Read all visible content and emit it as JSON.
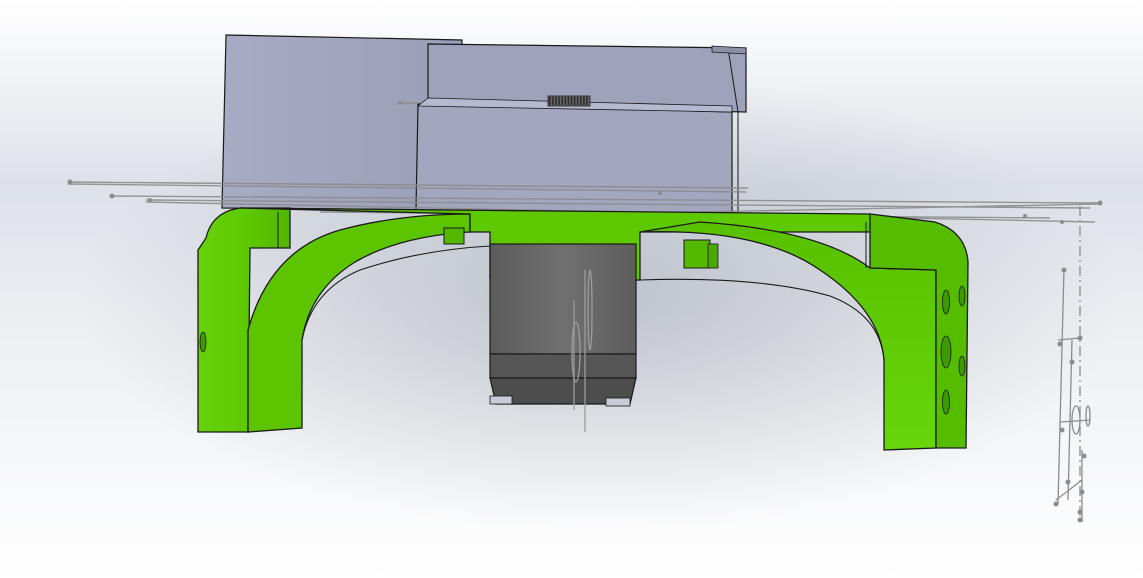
{
  "window": {
    "title": ""
  },
  "scene": {
    "background": {
      "top_color": "#ffffff",
      "mid_color": "#dde1e8",
      "bottom_color": "#ffffff"
    },
    "colors": {
      "green_body": "#5fcc00",
      "green_highlight": "#8ee63a",
      "green_shadow": "#3e9a00",
      "blue_grey_block": "#a0a4bd",
      "blue_grey_light": "#b3b7cd",
      "blue_grey_dark": "#868aa3",
      "motor_dark": "#5a5a5a",
      "motor_mid": "#6e6e6e",
      "motor_light": "#8a8a8a",
      "edge_black": "#1a1a1a",
      "sketch_grey": "#8c8c8c"
    },
    "parts": [
      {
        "name": "upper-enclosure-block",
        "color_key": "blue_grey_block"
      },
      {
        "name": "green-frame-bracket",
        "color_key": "green_body"
      },
      {
        "name": "stepper-motor",
        "color_key": "motor_dark"
      },
      {
        "name": "drive-pulley",
        "color_key": "motor_mid"
      },
      {
        "name": "reference-sketch-lines",
        "color_key": "sketch_grey"
      }
    ]
  }
}
